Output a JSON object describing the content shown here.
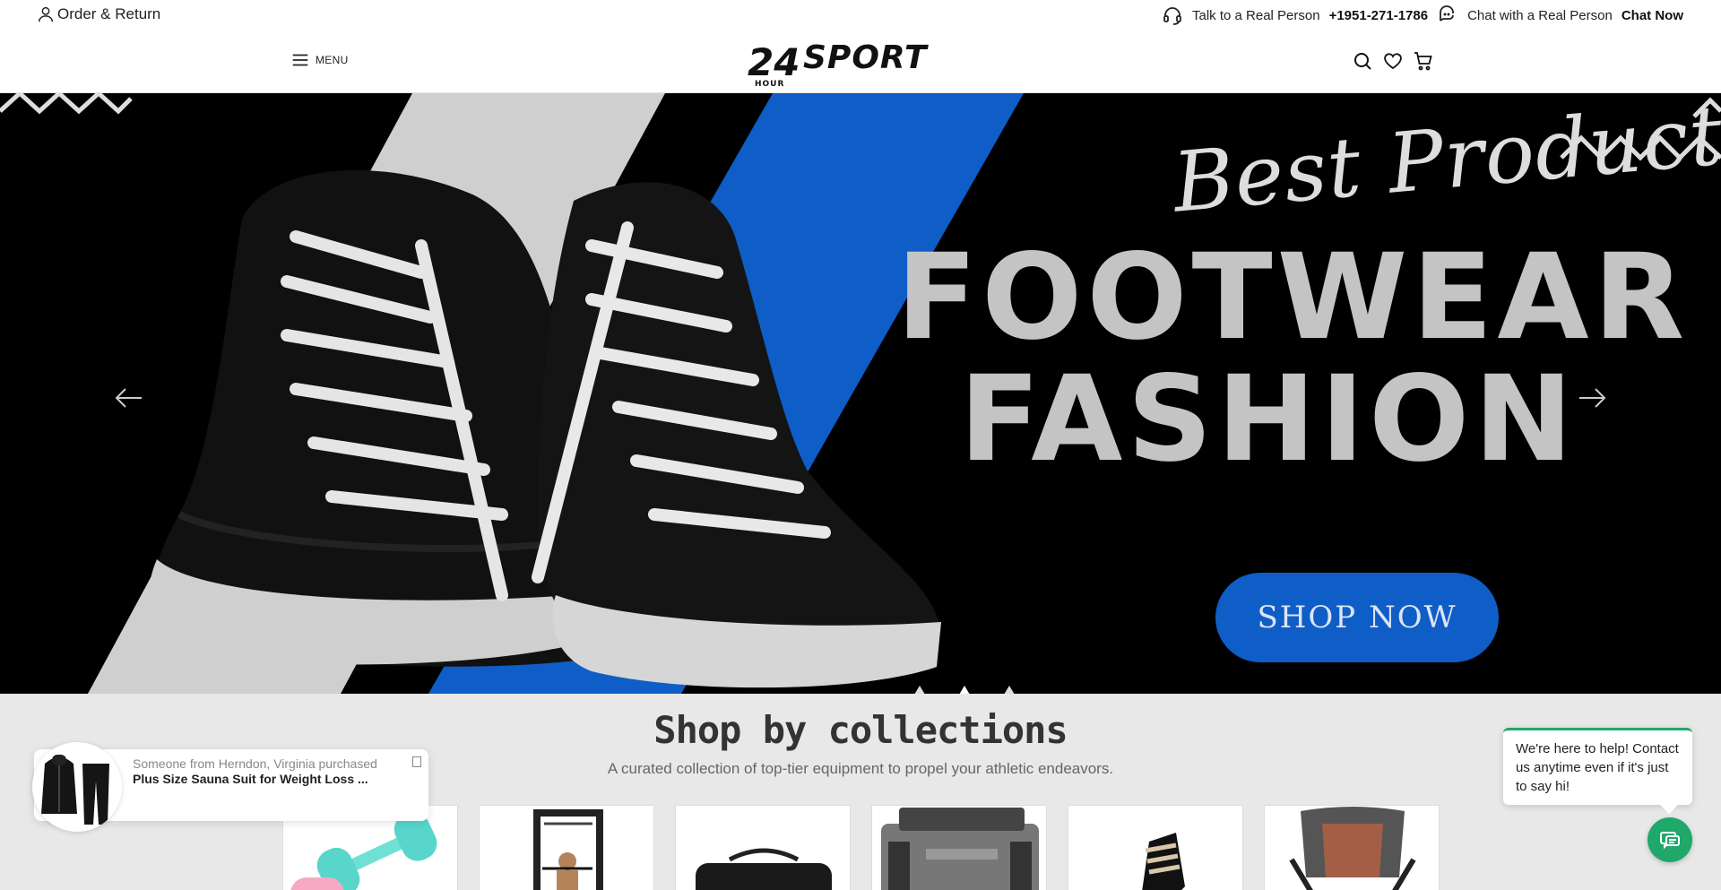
{
  "topbar": {
    "order_return": "Order & Return",
    "talk_label": "Talk to a Real Person",
    "phone": "+1951-271-1786",
    "chat_label": "Chat with a Real Person",
    "chat_now": "Chat Now"
  },
  "header": {
    "menu_label": "MENU",
    "logo_text": "24 SPORT",
    "logo_sub": "HOUR",
    "icons": [
      "search-icon",
      "heart-icon",
      "cart-icon"
    ]
  },
  "hero": {
    "script_text": "Best Product",
    "headline_line1": "FOOTWEAR",
    "headline_line2": "FASHION",
    "cta_label": "SHOP NOW",
    "slides": 3,
    "active_slide": 2,
    "accent": "#0f5dc6"
  },
  "collections": {
    "title": "Shop by collections",
    "subtitle": "A curated collection of top-tier equipment to propel your athletic endeavors.",
    "items": [
      "dumbbells",
      "home gym",
      "duffel bag",
      "cooler bag",
      "boots",
      "camping chair"
    ]
  },
  "purchase_popup": {
    "line1": "Someone from Herndon, Virginia purchased",
    "line2": "Plus Size Sauna Suit for Weight Loss ..."
  },
  "chat_widget": {
    "message": "We're here to help! Contact us anytime even if it's just to say hi!",
    "accent": "#1fa86a"
  }
}
